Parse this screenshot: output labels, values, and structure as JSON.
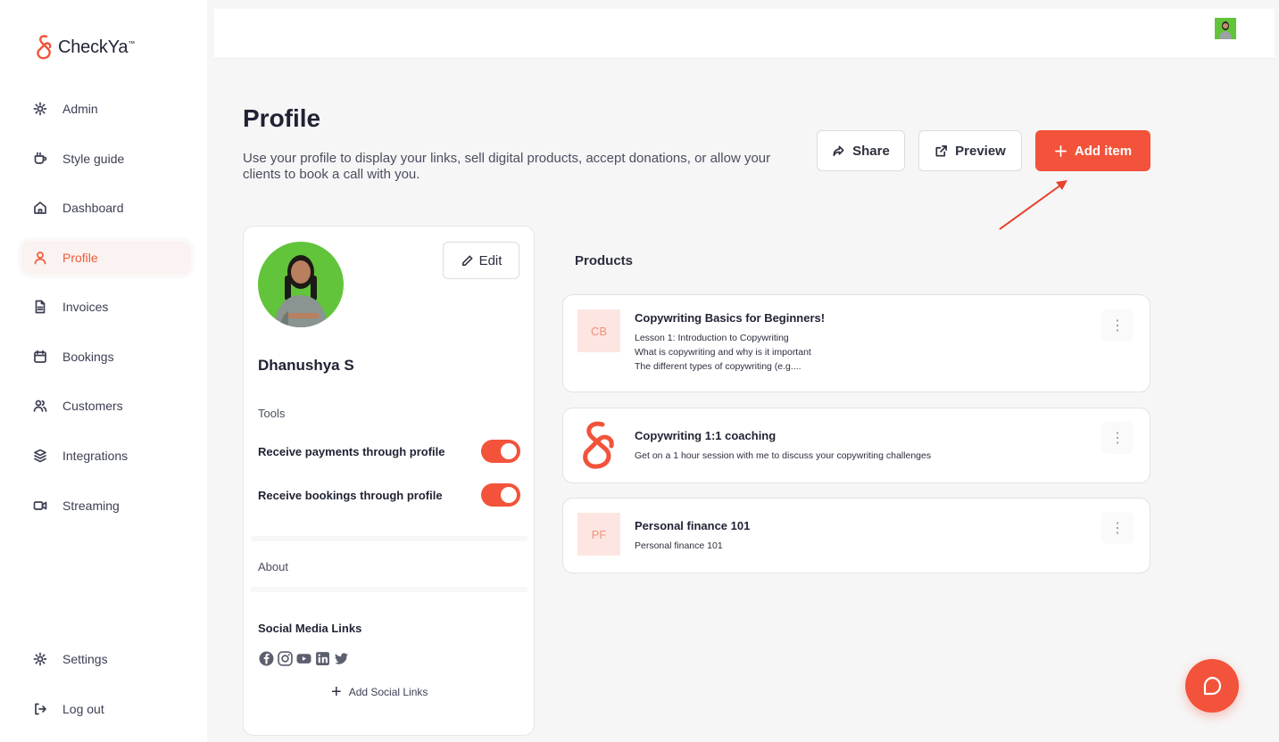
{
  "brand": {
    "name": "CheckYa",
    "tm": "™",
    "accent": "#f2533a"
  },
  "sidebar": {
    "items": [
      {
        "label": "Admin",
        "icon": "admin-gear-icon"
      },
      {
        "label": "Style guide",
        "icon": "cup-icon"
      },
      {
        "label": "Dashboard",
        "icon": "home-icon"
      },
      {
        "label": "Profile",
        "icon": "user-icon",
        "active": true
      },
      {
        "label": "Invoices",
        "icon": "document-icon"
      },
      {
        "label": "Bookings",
        "icon": "calendar-icon"
      },
      {
        "label": "Customers",
        "icon": "users-icon"
      },
      {
        "label": "Integrations",
        "icon": "layers-icon"
      },
      {
        "label": "Streaming",
        "icon": "video-icon"
      }
    ],
    "bottom": [
      {
        "label": "Settings",
        "icon": "gear-icon"
      },
      {
        "label": "Log out",
        "icon": "logout-icon"
      }
    ]
  },
  "header": {
    "title": "Profile",
    "description": "Use your profile to display your links, sell digital products, accept donations, or allow your clients to book a call with you.",
    "share_label": "Share",
    "preview_label": "Preview",
    "add_item_label": "Add item"
  },
  "profile": {
    "edit_label": "Edit",
    "name": "Dhanushya S",
    "tools_label": "Tools",
    "toggles": [
      {
        "label": "Receive payments through profile",
        "on": true
      },
      {
        "label": "Receive bookings through profile",
        "on": true
      }
    ],
    "about_label": "About",
    "social_title": "Social Media Links",
    "social_icons": [
      "facebook-icon",
      "instagram-icon",
      "youtube-icon",
      "linkedin-icon",
      "twitter-icon"
    ],
    "add_social_label": "Add Social Links"
  },
  "products": {
    "title": "Products",
    "items": [
      {
        "thumb": "CB",
        "title": "Copywriting Basics for Beginners!",
        "description": "Lesson 1: Introduction to Copywriting\nWhat is copywriting and why is it important\nThe different types of copywriting (e.g...."
      },
      {
        "thumb": "",
        "title": "Copywriting 1:1 coaching",
        "description": "Get on a 1 hour session with me to discuss your copywriting challenges"
      },
      {
        "thumb": "PF",
        "title": "Personal finance 101",
        "description": "Personal finance 101"
      }
    ]
  }
}
